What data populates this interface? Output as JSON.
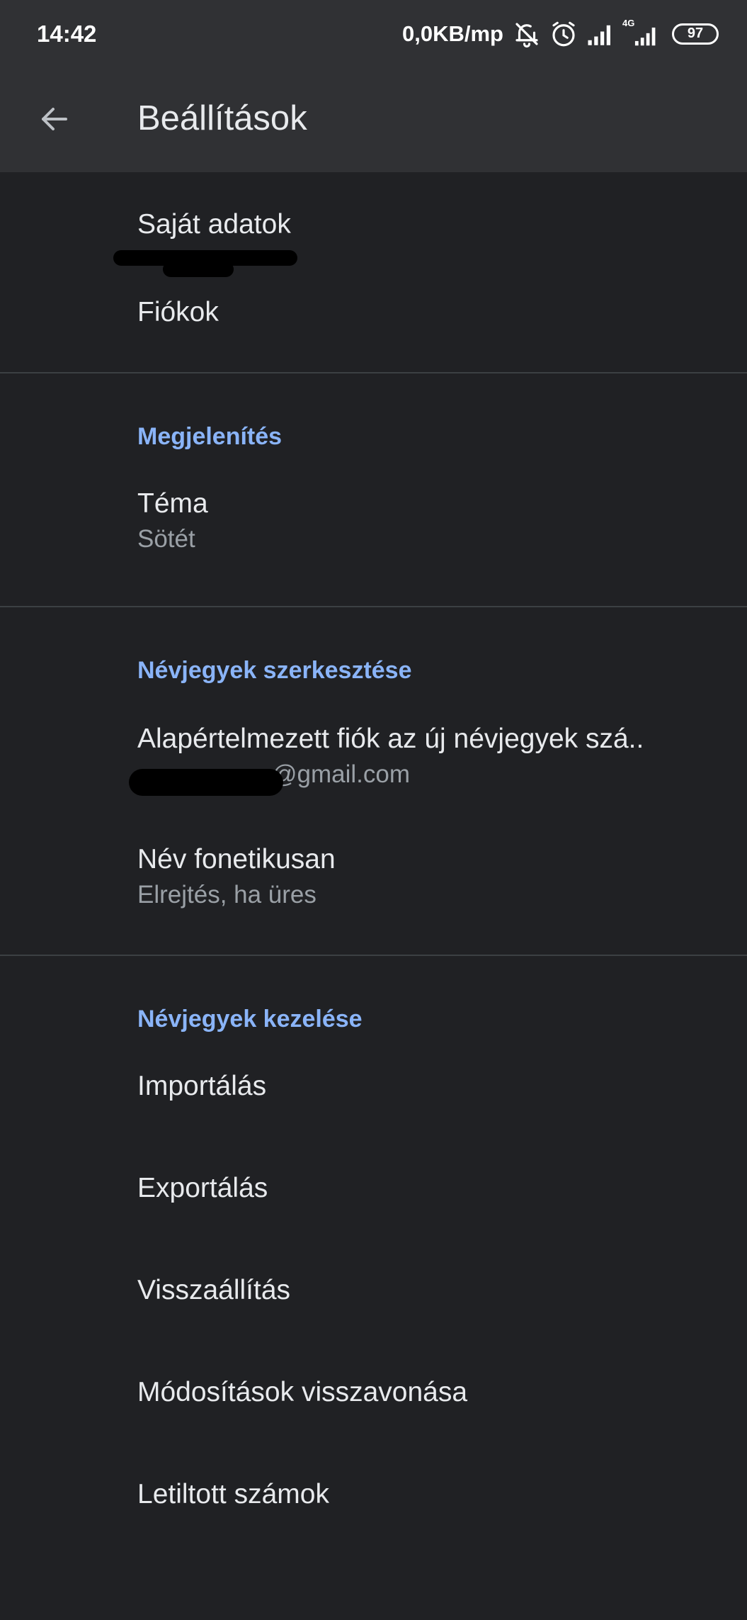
{
  "status_bar": {
    "time": "14:42",
    "speed": "0,0KB/mp",
    "network_type": "4G",
    "battery": "97",
    "icons": [
      "bell-off-icon",
      "alarm-icon",
      "signal-icon",
      "signal-4g-icon",
      "battery-icon"
    ]
  },
  "app_bar": {
    "title": "Beállítások",
    "back_icon": "arrow-back-icon"
  },
  "settings": {
    "my_info": {
      "label": "Saját adatok"
    },
    "accounts": {
      "label": "Fiókok"
    },
    "display": {
      "header": "Megjelenítés",
      "theme": {
        "label": "Téma",
        "value": "Sötét"
      }
    },
    "edit_contacts": {
      "header": "Névjegyek szerkesztése",
      "default_account": {
        "label": "Alapértelmezett fiók az új névjegyek szá..",
        "value": "@gmail.com"
      },
      "phonetic_name": {
        "label": "Név fonetikusan",
        "value": "Elrejtés, ha üres"
      }
    },
    "manage_contacts": {
      "header": "Névjegyek kezelése",
      "items": [
        "Importálás",
        "Exportálás",
        "Visszaállítás",
        "Módosítások visszavonása",
        "Letiltott számok"
      ]
    }
  },
  "colors": {
    "background": "#202124",
    "appbar": "#303134",
    "accent": "#8ab4f8",
    "text_primary": "#e8eaed",
    "text_secondary": "#9aa0a6",
    "divider": "#3c4043"
  }
}
